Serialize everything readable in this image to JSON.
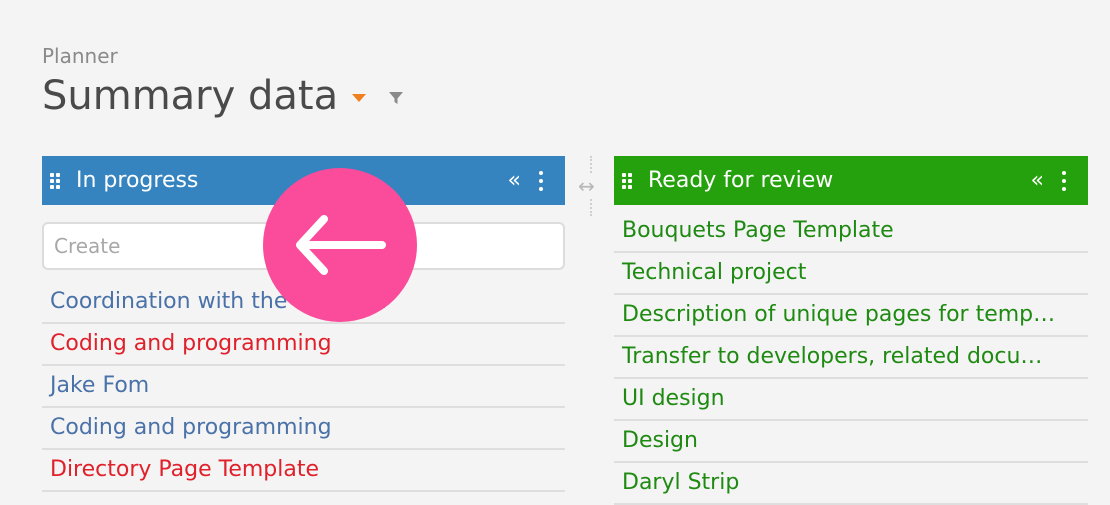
{
  "breadcrumb": "Planner",
  "title": "Summary data",
  "columns": {
    "left": {
      "title": "In progress",
      "color": "#3584c0",
      "create_placeholder": "Create",
      "items": [
        {
          "label": "Coordination with the designer",
          "color": "blue"
        },
        {
          "label": "Coding and programming",
          "color": "red"
        },
        {
          "label": "Jake Fom",
          "color": "blue"
        },
        {
          "label": "Coding and programming",
          "color": "blue"
        },
        {
          "label": "Directory Page Template",
          "color": "red"
        }
      ]
    },
    "right": {
      "title": "Ready for review",
      "color": "#24a10c",
      "items": [
        {
          "label": "Bouquets Page Template"
        },
        {
          "label": "Technical project"
        },
        {
          "label": "Description of unique pages for temp…"
        },
        {
          "label": "Transfer to developers, related docu…"
        },
        {
          "label": "UI design"
        },
        {
          "label": "Design"
        },
        {
          "label": "Daryl Strip"
        }
      ]
    }
  },
  "icons": {
    "collapse": "«",
    "resize": "↔",
    "overlay": "arrow-left-icon"
  }
}
